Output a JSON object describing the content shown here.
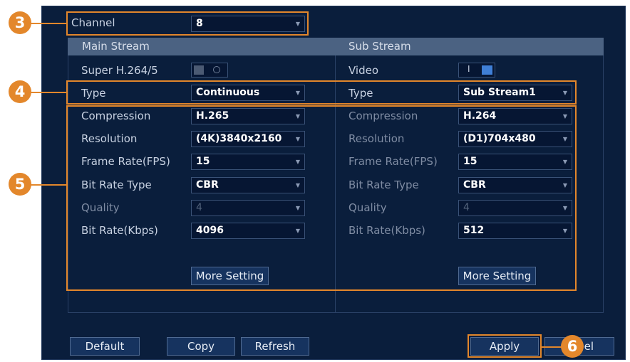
{
  "channel": {
    "label": "Channel",
    "value": "8"
  },
  "main_stream": {
    "title": "Main Stream",
    "super_label": "Super H.264/5",
    "type": {
      "label": "Type",
      "value": "Continuous"
    },
    "compression": {
      "label": "Compression",
      "value": "H.265"
    },
    "resolution": {
      "label": "Resolution",
      "value": "(4K)3840x2160"
    },
    "frame_rate": {
      "label": "Frame Rate(FPS)",
      "value": "15"
    },
    "bit_rate_type": {
      "label": "Bit Rate Type",
      "value": "CBR"
    },
    "quality": {
      "label": "Quality",
      "value": "4"
    },
    "bit_rate": {
      "label": "Bit Rate(Kbps)",
      "value": "4096"
    },
    "more_setting": "More Setting"
  },
  "sub_stream": {
    "title": "Sub Stream",
    "video_label": "Video",
    "type": {
      "label": "Type",
      "value": "Sub Stream1"
    },
    "compression": {
      "label": "Compression",
      "value": "H.264"
    },
    "resolution": {
      "label": "Resolution",
      "value": "(D1)704x480"
    },
    "frame_rate": {
      "label": "Frame Rate(FPS)",
      "value": "15"
    },
    "bit_rate_type": {
      "label": "Bit Rate Type",
      "value": "CBR"
    },
    "quality": {
      "label": "Quality",
      "value": "4"
    },
    "bit_rate": {
      "label": "Bit Rate(Kbps)",
      "value": "512"
    },
    "more_setting": "More Setting"
  },
  "footer": {
    "default": "Default",
    "copy": "Copy",
    "refresh": "Refresh",
    "apply": "Apply",
    "cancel_visible": "el"
  },
  "callouts": {
    "c3": "3",
    "c4": "4",
    "c5": "5",
    "c6": "6"
  },
  "toggle_on_glyph": "I",
  "dropdown_glyph": "▼",
  "colors": {
    "background": "#0a1e3c",
    "header": "#4b6282",
    "callout": "#e3872b",
    "button": "#16335f",
    "toggle_on": "#3f7fd6"
  }
}
